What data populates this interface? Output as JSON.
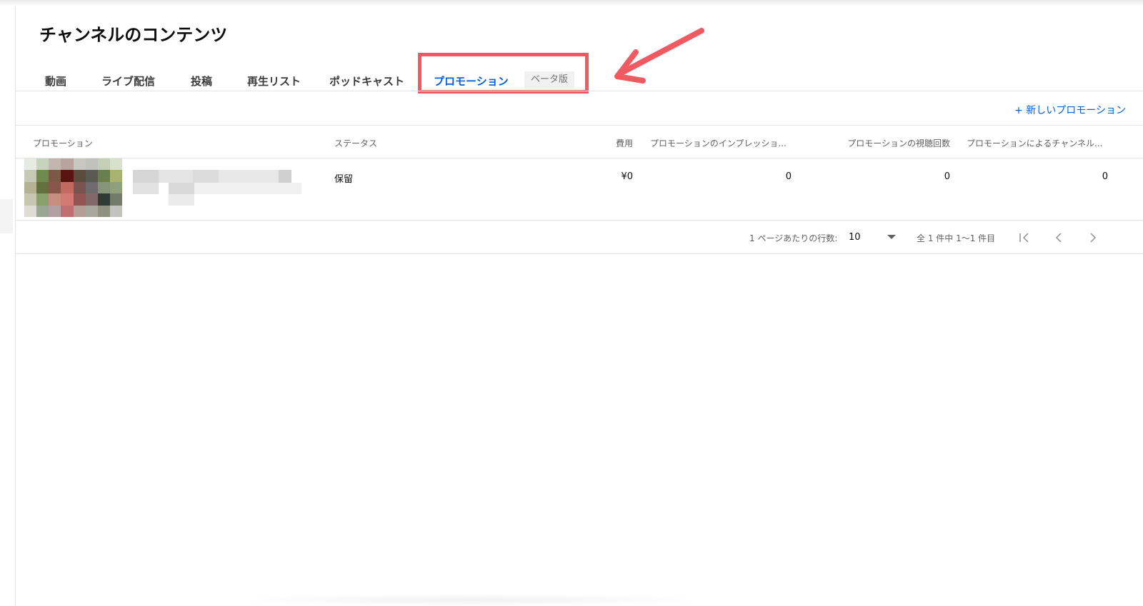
{
  "header": {
    "title": "チャンネルのコンテンツ"
  },
  "tabs": [
    {
      "label": "動画"
    },
    {
      "label": "ライブ配信"
    },
    {
      "label": "投稿"
    },
    {
      "label": "再生リスト"
    },
    {
      "label": "ポッドキャスト"
    },
    {
      "label": "プロモーション",
      "active": true,
      "badge": "ベータ版"
    }
  ],
  "toolbar": {
    "new_promotion_label": "+ 新しいプロモーション"
  },
  "table": {
    "columns": [
      "プロモーション",
      "ステータス",
      "費用",
      "プロモーションのインプレッショ...",
      "プロモーションの視聴回数",
      "プロモーションによるチャンネル..."
    ],
    "rows": [
      {
        "status": "保留",
        "cost": "¥0",
        "impressions": "0",
        "views": "0",
        "channel": "0"
      }
    ]
  },
  "pagination": {
    "rows_per_page_label": "1 ページあたりの行数:",
    "rows_per_page_value": "10",
    "range_label": "全 1 件中 1〜1 件目"
  },
  "colors": {
    "accent": "#065fd4",
    "highlight": "#f05a60",
    "divider": "#e5e5e5",
    "muted_text": "#606060"
  },
  "icons": {
    "first_page": "first-page-icon",
    "prev_page": "chevron-left-icon",
    "next_page": "chevron-right-icon",
    "dropdown": "caret-down-icon"
  }
}
